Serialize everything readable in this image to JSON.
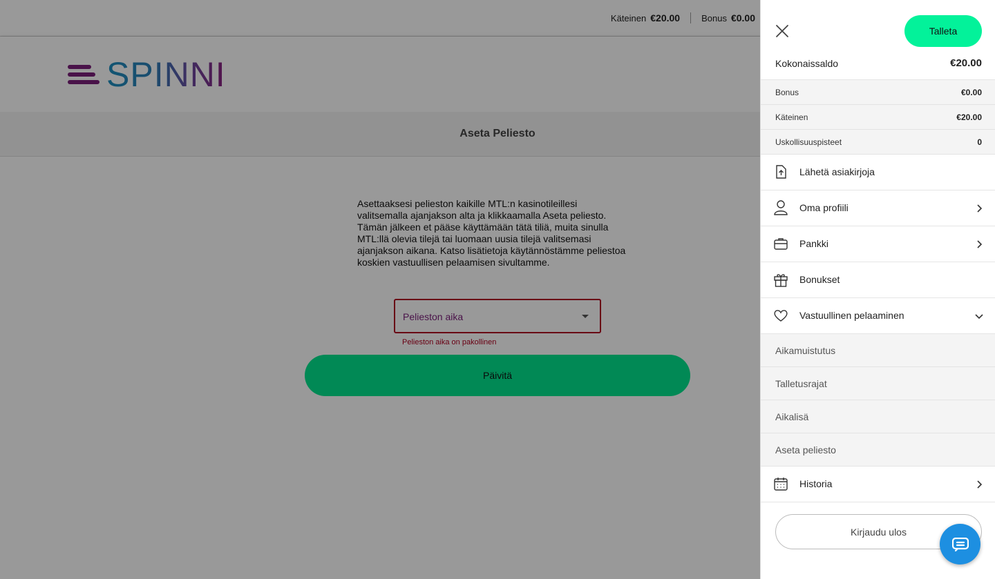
{
  "topbar": {
    "cash_label": "Käteinen",
    "cash_value": "€20.00",
    "bonus_label": "Bonus",
    "bonus_value": "€0.00"
  },
  "brand": {
    "logo_text": "SPINNI"
  },
  "page": {
    "title": "Aseta Peliesto",
    "description": "Asettaaksesi pelieston kaikille MTL:n kasinotileillesi valitsemalla ajanjakson alta ja klikkaamalla Aseta peliesto. Tämän jälkeen et pääse käyttämään tätä tiliä, muita sinulla MTL:llä olevia tilejä tai luomaan uusia tilejä valitsemasi ajanjakson aikana. Katso lisätietoja käytännöstämme peliestoa koskien vastuullisen pelaamisen sivultamme.",
    "select_placeholder": "Pelieston aika",
    "error": "Pelieston aika on pakollinen",
    "submit_label": "Päivitä"
  },
  "panel": {
    "deposit_label": "Talleta",
    "total": {
      "label": "Kokonaissaldo",
      "value": "€20.00"
    },
    "balances": [
      {
        "label": "Bonus",
        "value": "€0.00"
      },
      {
        "label": "Käteinen",
        "value": "€20.00"
      },
      {
        "label": "Uskollisuuspisteet",
        "value": "0"
      }
    ],
    "menu": {
      "upload": "Lähetä asiakirjoja",
      "profile": "Oma profiili",
      "bank": "Pankki",
      "bonuses": "Bonukset",
      "responsible": "Vastuullinen pelaaminen",
      "history": "Historia"
    },
    "submenu": [
      "Aikamuistutus",
      "Talletusrajat",
      "Aikalisä",
      "Aseta peliesto"
    ],
    "logout_label": "Kirjaudu ulos"
  },
  "colors": {
    "accent_green": "#03e48e",
    "brand_purple": "#7b1f7a",
    "error_red": "#b00020",
    "chat_blue": "#1d8fe1"
  },
  "icons": [
    "close-icon",
    "upload-document-icon",
    "user-icon",
    "briefcase-icon",
    "gift-icon",
    "heart-icon",
    "calendar-icon",
    "chevron-right-icon",
    "chevron-down-icon",
    "chat-icon",
    "dropdown-caret-icon"
  ]
}
